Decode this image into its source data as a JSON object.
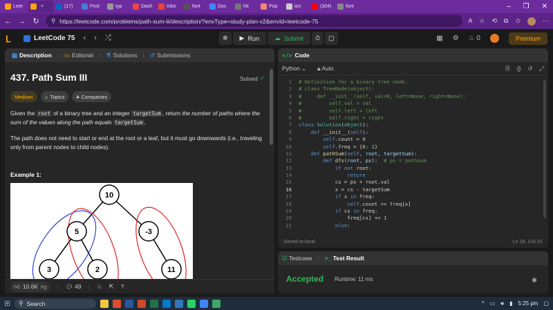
{
  "browser": {
    "tabs": [
      "Leet",
      "",
      "(17)",
      "Post",
      "typ",
      "Dash",
      "Inbo",
      "font",
      "Doc",
      "htt",
      "Pop",
      "ion",
      "(304)",
      "font"
    ],
    "url": "https://leetcode.com/problems/path-sum-iii/description/?envType=study-plan-v2&envId=leetcode-75"
  },
  "header": {
    "title": "LeetCode 75",
    "run_label": "Run",
    "submit_label": "Submit",
    "streak": "0",
    "premium_label": "Premium"
  },
  "left": {
    "tabs": [
      "Description",
      "Editorial",
      "Solutions",
      "Submissions"
    ],
    "problem_title": "437. Path Sum III",
    "solved_label": "Solved",
    "chips": [
      "Medium",
      "Topics",
      "Companies"
    ],
    "para1_a": "Given the ",
    "para1_code1": "root",
    "para1_b": " of a binary tree and an integer ",
    "para1_code2": "targetSum",
    "para1_c": ", return ",
    "para1_em": "the number of paths where the sum of the values along the path equals ",
    "para1_code3": "targetSum",
    "para1_d": ".",
    "para2": "The path does not need to start or end at the root or a leaf, but it must go downwards (i.e., traveling only from parent nodes to child nodes).",
    "example_title": "Example 1:",
    "tree_nodes": [
      "10",
      "5",
      "-3",
      "3",
      "2",
      "11"
    ],
    "likes": "10.6K",
    "comments": "49"
  },
  "editor": {
    "panel_title": "Code",
    "language": "Python",
    "mode": "Auto",
    "status": "Saved to local",
    "cursor": "Ln 16, Col 31"
  },
  "tests": {
    "tab_testcase": "Testcase",
    "tab_result": "Test Result",
    "verdict": "Accepted",
    "runtime": "Runtime: 11 ms"
  },
  "taskbar": {
    "search_label": "Search",
    "time": "5:25 pm"
  }
}
